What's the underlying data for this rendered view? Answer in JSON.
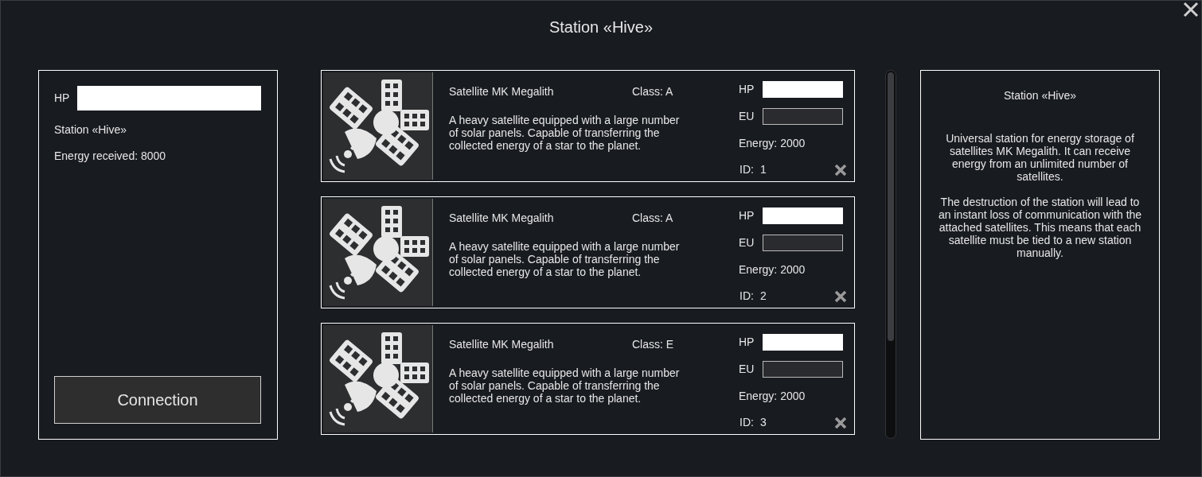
{
  "window": {
    "title": "Station «Hive»"
  },
  "station": {
    "hp": {
      "label": "HP",
      "level": 1
    },
    "name": "Station «Hive»",
    "energy": "Energy received: 8000",
    "button": "Connection"
  },
  "satellites": [
    {
      "name": "Satellite MK Megalith",
      "class": "Class: A",
      "description": "A heavy satellite equipped with a large number of solar panels. Capable of transferring the collected energy of a star to the planet.",
      "hp": {
        "label": "HP",
        "level": 1
      },
      "eu": {
        "label": "EU",
        "level": 0
      },
      "energy": "Energy: 2000",
      "id_label": "ID:",
      "id": "1"
    },
    {
      "name": "Satellite MK Megalith",
      "class": "Class: A",
      "description": "A heavy satellite equipped with a large number of solar panels. Capable of transferring the collected energy of a star to the planet.",
      "hp": {
        "label": "HP",
        "level": 1
      },
      "eu": {
        "label": "EU",
        "level": 0
      },
      "energy": "Energy: 2000",
      "id_label": "ID:",
      "id": "2"
    },
    {
      "name": "Satellite MK Megalith",
      "class": "Class: E",
      "description": "A heavy satellite equipped with a large number of solar panels. Capable of transferring the collected energy of a star to the planet.",
      "hp": {
        "label": "HP",
        "level": 1
      },
      "eu": {
        "label": "EU",
        "level": 0
      },
      "energy": "Energy: 2000",
      "id_label": "ID:",
      "id": "3"
    }
  ],
  "info": {
    "title": "Station «Hive»",
    "paragraphs": [
      "Universal station for energy storage of satellites MK Megalith. It can receive energy from an unlimited number of satellites.",
      "The destruction of the station will lead to an instant loss of communication with the attached satellites. This means that each satellite must be tied to a new station manually."
    ]
  }
}
